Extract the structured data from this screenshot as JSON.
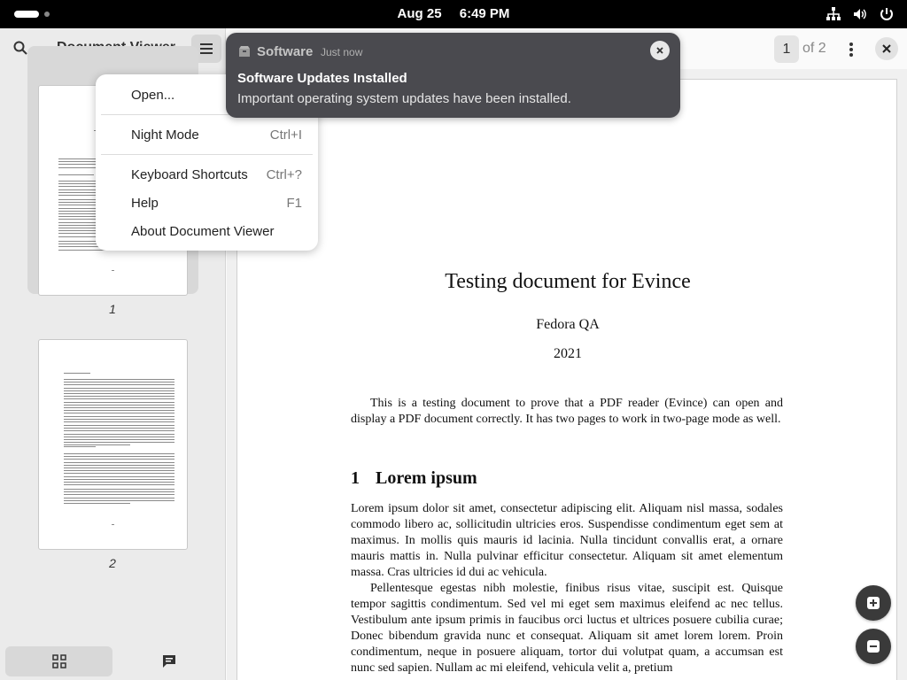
{
  "topbar": {
    "date": "Aug 25",
    "time": "6:49 PM",
    "icons": [
      "activities-icon",
      "network-icon",
      "volume-icon",
      "power-icon"
    ]
  },
  "sidebar": {
    "title": "Document Viewer",
    "icons": [
      "search-icon",
      "hamburger-menu-icon"
    ],
    "thumbnails": [
      {
        "label": "1",
        "selected": true
      },
      {
        "label": "2",
        "selected": false
      }
    ],
    "bottom_buttons": [
      "grid-icon",
      "annotations-icon"
    ]
  },
  "toolbar": {
    "page_number": "1",
    "page_of": "of 2",
    "icons": [
      "more-options-icon",
      "close-icon"
    ]
  },
  "menu": {
    "items": [
      {
        "label": "Open...",
        "shortcut": ""
      },
      {
        "label": "Night Mode",
        "shortcut": "Ctrl+I"
      },
      {
        "label": "Keyboard Shortcuts",
        "shortcut": "Ctrl+?"
      },
      {
        "label": "Help",
        "shortcut": "F1"
      },
      {
        "label": "About Document Viewer",
        "shortcut": ""
      }
    ]
  },
  "notification": {
    "app": "Software",
    "time": "Just now",
    "title": "Software Updates Installed",
    "body": "Important operating system updates have been installed.",
    "icon": "package-icon"
  },
  "document": {
    "title": "Testing document for Evince",
    "author": "Fedora QA",
    "year": "2021",
    "abstract": "This is a testing document to prove that a PDF reader (Evince) can open and display a PDF document correctly. It has two pages to work in two-page mode as well.",
    "section_number": "1",
    "section_title": "Lorem ipsum",
    "paragraph1": "Lorem ipsum dolor sit amet, consectetur adipiscing elit. Aliquam nisl massa, sodales commodo libero ac, sollicitudin ultricies eros. Suspendisse condimentum eget sem at maximus. In mollis quis mauris id lacinia. Nulla tincidunt convallis erat, a ornare mauris mattis in. Nulla pulvinar efficitur consectetur. Aliquam sit amet elementum massa. Cras ultricies id dui ac vehicula.",
    "paragraph2": "Pellentesque egestas nibh molestie, finibus risus vitae, suscipit est. Quisque tempor sagittis condimentum. Sed vel mi eget sem maximus eleifend ac nec tellus. Vestibulum ante ipsum primis in faucibus orci luctus et ultrices posuere cubilia curae; Donec bibendum gravida nunc et consequat. Aliquam sit amet lorem lorem. Proin condimentum, neque in posuere aliquam, tortor dui volutpat quam, a accumsan est nunc sed sapien. Nullam ac mi eleifend, vehicula velit a, pretium"
  },
  "zoom": {
    "icons": [
      "zoom-in-icon",
      "zoom-out-icon"
    ]
  }
}
